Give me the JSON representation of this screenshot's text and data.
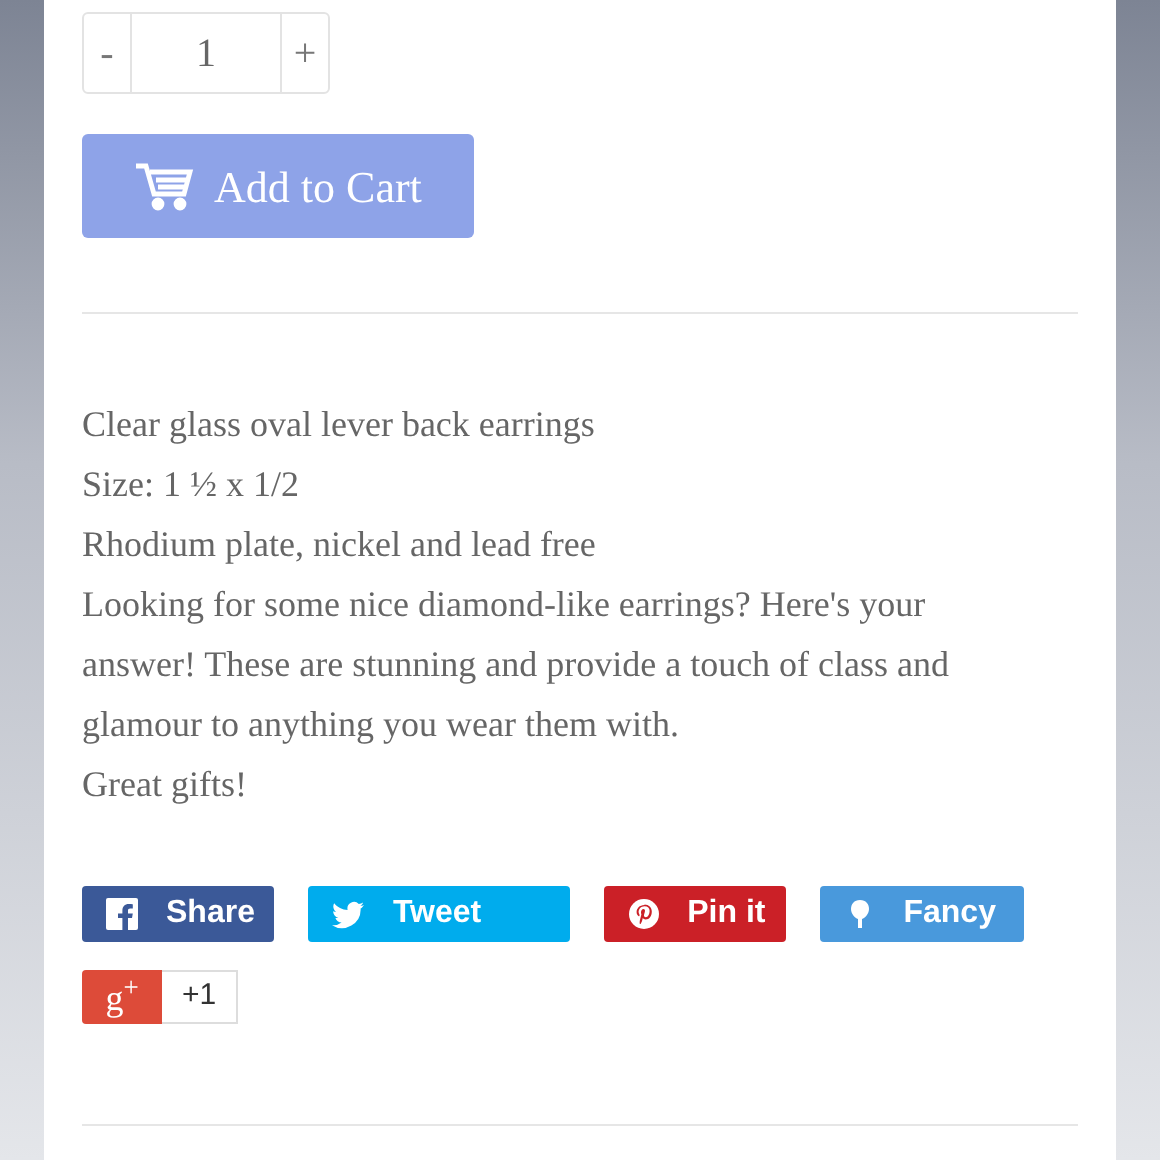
{
  "quantity": {
    "minus": "-",
    "value": "1",
    "plus": "+"
  },
  "add_to_cart": {
    "label": "Add to Cart"
  },
  "description": [
    "Clear glass oval lever back earrings",
    "Size: 1 ½ x 1/2",
    "Rhodium plate, nickel and lead free",
    "Looking for some nice diamond-like earrings? Here's your answer! These are stunning and provide a touch of class and glamour to anything you wear them with.",
    "Great gifts!"
  ],
  "share_buttons": [
    {
      "kind": "facebook",
      "label": "Share",
      "color": "#3b5998"
    },
    {
      "kind": "twitter",
      "label": "Tweet",
      "color": "#00aced"
    },
    {
      "kind": "pinterest",
      "label": "Pin it",
      "color": "#cb2027"
    },
    {
      "kind": "fancy",
      "label": "Fancy",
      "color": "#4999dc"
    }
  ],
  "google_plus": {
    "logo": "g$^{+}$",
    "count": "+1"
  }
}
